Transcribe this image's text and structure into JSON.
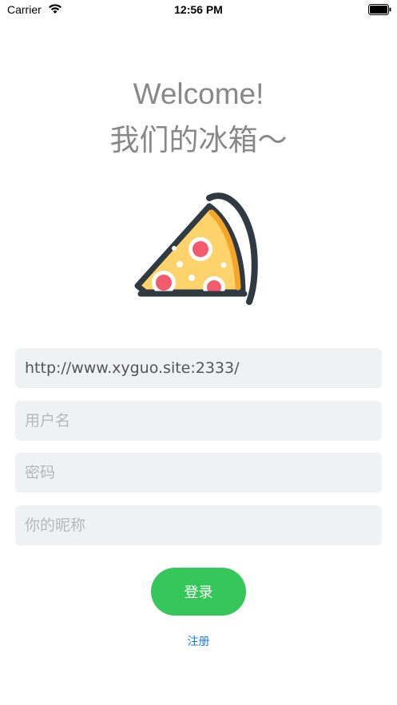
{
  "status_bar": {
    "carrier": "Carrier",
    "time": "12:56 PM"
  },
  "header": {
    "welcome": "Welcome!",
    "subtitle": "我们的冰箱～"
  },
  "form": {
    "server_url_value": "http://www.xyguo.site:2333/",
    "username_placeholder": "用户名",
    "password_placeholder": "密码",
    "nickname_placeholder": "你的昵称"
  },
  "actions": {
    "login_label": "登录",
    "register_label": "注册"
  },
  "colors": {
    "accent": "#35c759",
    "link": "#1a7ae8",
    "field_bg": "#eff2f3"
  },
  "icons": {
    "logo": "pizza-slice-icon"
  }
}
